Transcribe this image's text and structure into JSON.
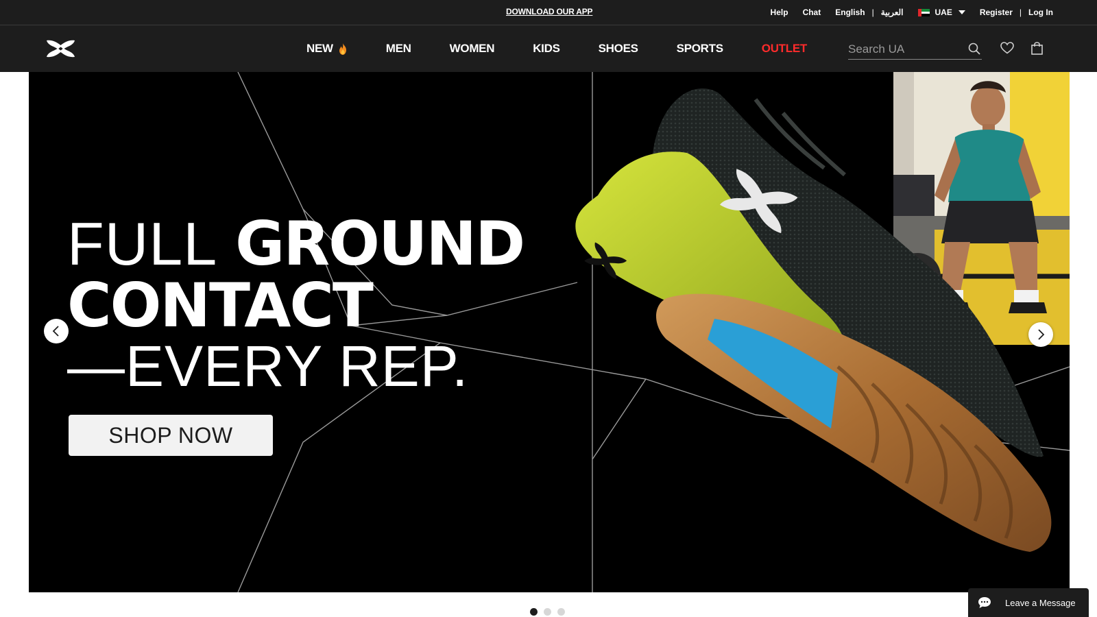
{
  "utility_bar": {
    "download_app": "DOWNLOAD OUR APP",
    "help": "Help",
    "chat": "Chat",
    "lang_english": "English",
    "separator": "|",
    "lang_arabic": "العربية",
    "country": "UAE",
    "register": "Register",
    "login": "Log In"
  },
  "header": {
    "logo": "under-armour-logo",
    "nav": [
      {
        "label": "NEW"
      },
      {
        "label": "MEN"
      },
      {
        "label": "WOMEN"
      },
      {
        "label": "KIDS"
      },
      {
        "label": "SHOES"
      },
      {
        "label": "SPORTS"
      },
      {
        "label": "OUTLET"
      }
    ],
    "search_placeholder": "Search UA",
    "icons": [
      "search-icon",
      "heart-icon",
      "bag-icon",
      "flame-icon"
    ]
  },
  "hero": {
    "headline_thin": "FULL",
    "headline_bold": "GROUND",
    "headline_line2": "CONTACT",
    "headline_line3": "—EVERY REP.",
    "cta": "SHOP NOW",
    "slides_total": 3,
    "active_slide": 1
  },
  "chat_widget": {
    "label": "Leave a Message"
  },
  "colors": {
    "header_bg": "#1d1d1d",
    "outlet": "#ff2b2b",
    "shoe_lime": "#c4d834",
    "shoe_blue": "#2a9fd6",
    "sole_gum": "#b27a3e"
  }
}
